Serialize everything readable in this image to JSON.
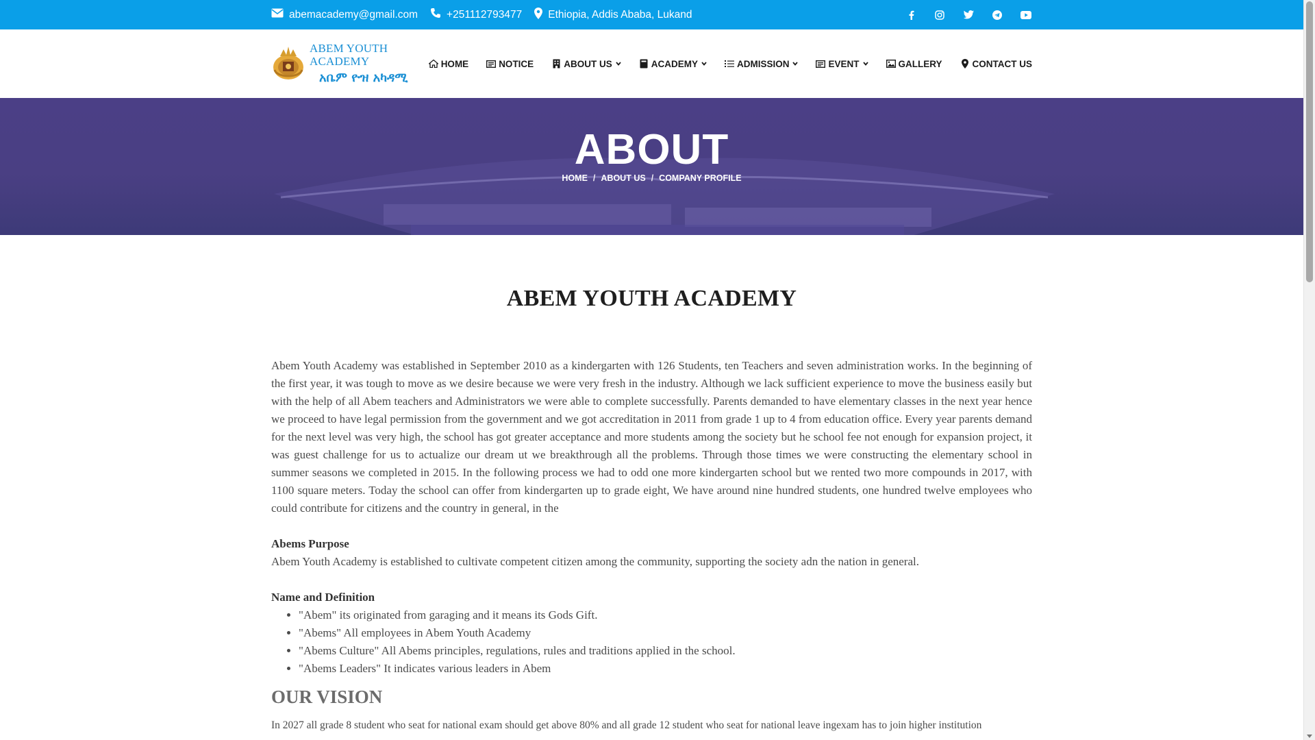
{
  "topbar": {
    "email": "abemacademy@gmail.com",
    "phone": "+251112793477",
    "location": "Ethiopia, Addis Ababa, Lukand",
    "social_icons": [
      "facebook-icon",
      "instagram-icon",
      "twitter-icon",
      "telegram-icon",
      "youtube-icon"
    ],
    "background": "#0a9fe8"
  },
  "logo": {
    "english": "ABEM YOUTH ACADEMY",
    "amharic": "አቤም ዮዝ አካዳሚ"
  },
  "nav": {
    "items": [
      {
        "label": "HOME",
        "icon": "home-icon",
        "dropdown": false
      },
      {
        "label": "NOTICE",
        "icon": "notice-icon",
        "dropdown": false
      },
      {
        "label": "ABOUT US",
        "icon": "building-icon",
        "dropdown": true
      },
      {
        "label": "ACADEMY",
        "icon": "book-icon",
        "dropdown": true
      },
      {
        "label": "ADMISSION",
        "icon": "list-icon",
        "dropdown": true
      },
      {
        "label": "EVENT",
        "icon": "event-icon",
        "dropdown": true
      },
      {
        "label": "GALLERY",
        "icon": "image-icon",
        "dropdown": false
      },
      {
        "label": "CONTACT US",
        "icon": "map-marker-icon",
        "dropdown": false
      }
    ]
  },
  "banner": {
    "title": "ABOUT",
    "breadcrumb": [
      "HOME",
      "ABOUT US",
      "COMPANY PROFILE"
    ]
  },
  "content": {
    "title": "ABEM YOUTH ACADEMY",
    "intro": "Abem Youth Academy was established  in September 2010 as a kindergarten with 126 Students, ten Teachers and seven administration works. In the beginning of the first year, it was tough to move as we desire because we were very fresh in the industry. Although we lack sufficient experience to move the business easily but with the help of all Abem teachers and Administrators we were able to complete successfully. Parents demanded to have elementary classes in the next year hence we proceed to have legal permission from the government and we got accreditation in 2011 from grade 1 up to 4 from education office. Every year parents demand for the next level was very high, the school has got greater acceptance and more students among the society but he school fee not enough for expansion project, it was guest challenge for us to actualize our dream ut we breakthrough all the problems. Through those times we were constructing the elementary school in summer seasons we completed in 2015. In the following process we had to odd one more kindergarten school but we rented two more compounds in 2017, with 1100 square meters. Today the school can offer from kindergarten up to grade eight, We have around nine hundred students, one hundred twelve employees who could contribute for citizens and the country in general, in the",
    "purpose_heading": "Abems Purpose",
    "purpose_text": "Abem Youth Academy is established to cultivate competent citizen among the community, supporting the society adn the nation in general.",
    "definition_heading": "Name and Definition",
    "definitions": [
      "\"Abem\" its originated from garaging and it means its Gods Gift.",
      "\"Abems\" All employees in Abem Youth Academy",
      "\"Abems Culture\" All Abems principles, regulations, rules and traditions applied in the school.",
      "\"Abems Leaders\" It indicates various leaders in Abem"
    ],
    "vision_heading": "OUR VISION",
    "vision_text": "In 2027 all grade 8 student who seat for national exam should get above 80% and all grade 12 student who seat for national leave ingexam has to join higher institution"
  }
}
